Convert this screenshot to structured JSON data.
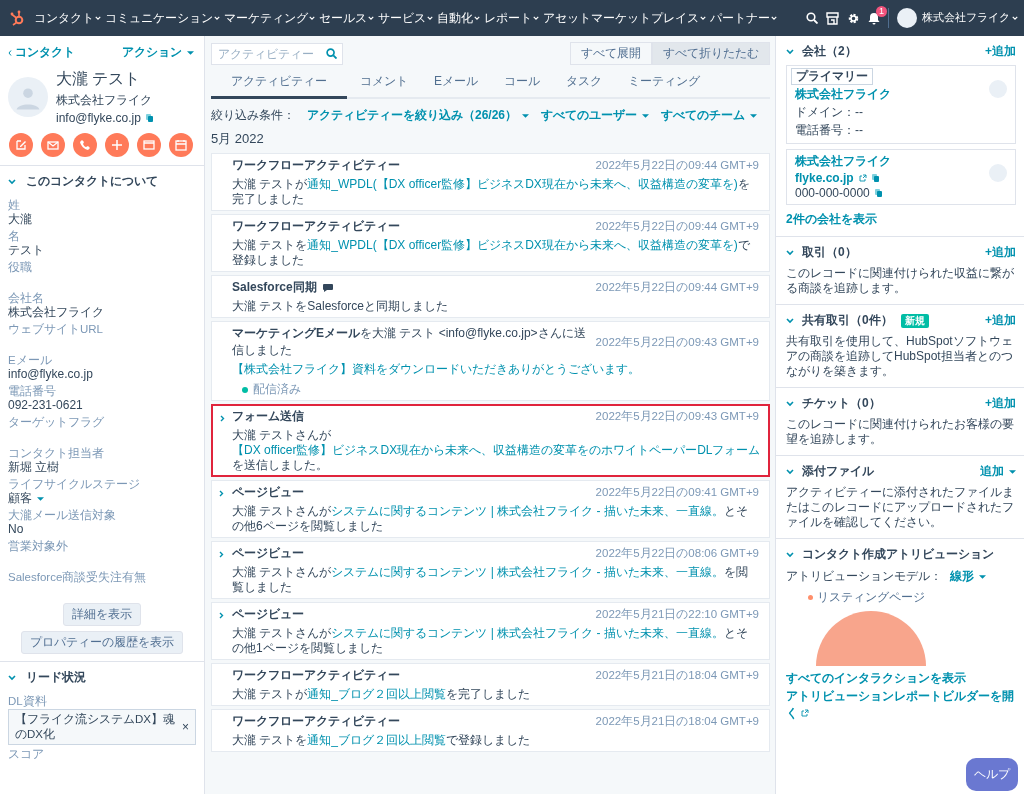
{
  "nav": {
    "items": [
      "コンタクト",
      "コミュニケーション",
      "マーケティング",
      "セールス",
      "サービス",
      "自動化",
      "レポート",
      "アセットマーケットプレイス",
      "パートナー"
    ],
    "notification_count": "1",
    "account": "株式会社フライク"
  },
  "contact": {
    "back": "コンタクト",
    "actions": "アクション",
    "name": "大瀧 テスト",
    "company": "株式会社フライク",
    "email": "info@flyke.co.jp"
  },
  "about": {
    "title": "このコンタクトについて",
    "expanded": true,
    "fields": [
      {
        "label": "姓",
        "kind": "text",
        "value": "大瀧"
      },
      {
        "label": "名",
        "kind": "text",
        "value": "テスト"
      },
      {
        "label": "役職",
        "kind": "text"
      },
      {
        "label": "会社名",
        "kind": "text",
        "value": "株式会社フライク"
      },
      {
        "label": "ウェブサイトURL",
        "kind": "text"
      },
      {
        "label": "Eメール",
        "kind": "text",
        "value": "info@flyke.co.jp"
      },
      {
        "label": "電話番号",
        "kind": "text",
        "value": "092-231-0621"
      },
      {
        "label": "ターゲットフラグ",
        "kind": "text"
      },
      {
        "label": "コンタクト担当者",
        "kind": "text",
        "value": "新堀 立樹"
      },
      {
        "label": "ライフサイクルステージ",
        "kind": "dropdown",
        "value": "顧客"
      },
      {
        "label": "大瀧メール送信対象",
        "kind": "text",
        "value": "No"
      },
      {
        "label": "営業対象外",
        "kind": "text"
      },
      {
        "label": "Salesforce商談受失注有無",
        "kind": "text"
      }
    ],
    "buttons": [
      "詳細を表示",
      "プロパティーの履歴を表示"
    ]
  },
  "lead": {
    "title": "リード状況",
    "expanded": true,
    "fields": [
      {
        "label": "DL資料",
        "kind": "tag",
        "value": "【フライク流システムDX】魂のDX化",
        "remove": "×"
      },
      {
        "label": "スコア",
        "kind": "text"
      }
    ]
  },
  "activity": {
    "search": {
      "placeholder": "アクティビティー"
    },
    "buttons": [
      {
        "label": "すべて展開",
        "selected": false
      },
      {
        "label": "すべて折りたたむ",
        "selected": true
      }
    ],
    "tabs": [
      {
        "label": "アクティビティー",
        "selected": true
      },
      {
        "label": "コメント",
        "selected": false
      },
      {
        "label": "Eメール",
        "selected": false
      },
      {
        "label": "コール",
        "selected": false
      },
      {
        "label": "タスク",
        "selected": false
      },
      {
        "label": "ミーティング",
        "selected": false
      }
    ],
    "filter_label": "絞り込み条件：",
    "filters": [
      "アクティビティーを絞り込み（26/26）",
      "すべてのユーザー",
      "すべてのチーム"
    ],
    "month": "5月 2022",
    "cards": [
      {
        "kind": "workflow",
        "highlighted": false,
        "title": "ワークフローアクティビティー",
        "time": "2022年5月22日の09:44 GMT+9",
        "body": [
          {
            "text": "大瀧 テストが",
            "link": false
          },
          {
            "text": "通知_WPDL(【DX officer監修】ビジネスDX現在から未来へ、収益構造の変革を)",
            "link": true
          },
          {
            "text": "を完了しました",
            "link": false
          }
        ]
      },
      {
        "kind": "workflow",
        "highlighted": false,
        "title": "ワークフローアクティビティー",
        "time": "2022年5月22日の09:44 GMT+9",
        "body": [
          {
            "text": "大瀧 テストを",
            "link": false
          },
          {
            "text": "通知_WPDL(【DX officer監修】ビジネスDX現在から未来へ、収益構造の変革を)",
            "link": true
          },
          {
            "text": "で登録しました",
            "link": false
          }
        ]
      },
      {
        "kind": "sync",
        "highlighted": false,
        "title": "Salesforce同期",
        "time": "2022年5月22日の09:44 GMT+9",
        "body": [
          {
            "text": "大瀧 テストをSalesforceと同期しました",
            "link": false
          }
        ]
      },
      {
        "kind": "email",
        "highlighted": false,
        "title": "**マーケティングEメール**を大瀧 テスト <info@flyke.co.jp>さんに送信しました",
        "time": "2022年5月22日の09:43 GMT+9",
        "body": [
          {
            "text": "【株式会社フライク】資料をダウンロードいただきありがとうございます。",
            "link": true
          }
        ],
        "status": "配信済み"
      },
      {
        "kind": "form",
        "highlighted": true,
        "title": "フォーム送信",
        "time": "2022年5月22日の09:43 GMT+9",
        "body": [
          {
            "text": "大瀧 テストさんが",
            "link": false
          },
          {
            "text": "【DX officer監修】ビジネスDX現在から未来へ、収益構造の変革をのホワイトペーパーDLフォーム",
            "link": true
          },
          {
            "text": "を送信しました。",
            "link": false
          }
        ]
      },
      {
        "kind": "pageview",
        "highlighted": false,
        "title": "ページビュー",
        "time": "2022年5月22日の09:41 GMT+9",
        "body": [
          {
            "text": "大瀧 テストさんが",
            "link": false
          },
          {
            "text": "システムに関するコンテンツ | 株式会社フライク - 描いた未来、一直線。",
            "link": true
          },
          {
            "text": "とその他6ページを閲覧しました",
            "link": false
          }
        ]
      },
      {
        "kind": "pageview",
        "highlighted": false,
        "title": "ページビュー",
        "time": "2022年5月22日の08:06 GMT+9",
        "body": [
          {
            "text": "大瀧 テストさんが",
            "link": false
          },
          {
            "text": "システムに関するコンテンツ | 株式会社フライク - 描いた未来、一直線。",
            "link": true
          },
          {
            "text": "を閲覧しました",
            "link": false
          }
        ]
      },
      {
        "kind": "pageview",
        "highlighted": false,
        "title": "ページビュー",
        "time": "2022年5月21日の22:10 GMT+9",
        "body": [
          {
            "text": "大瀧 テストさんが",
            "link": false
          },
          {
            "text": "システムに関するコンテンツ | 株式会社フライク - 描いた未来、一直線。",
            "link": true
          },
          {
            "text": "とその他1ページを閲覧しました",
            "link": false
          }
        ]
      },
      {
        "kind": "workflow",
        "highlighted": false,
        "title": "ワークフローアクティビティー",
        "time": "2022年5月21日の18:04 GMT+9",
        "body": [
          {
            "text": "大瀧 テストが",
            "link": false
          },
          {
            "text": "通知_ブログ２回以上閲覧",
            "link": true
          },
          {
            "text": "を完了しました",
            "link": false
          }
        ]
      },
      {
        "kind": "workflow",
        "highlighted": false,
        "title": "ワークフローアクティビティー",
        "time": "2022年5月21日の18:04 GMT+9",
        "body": [
          {
            "text": "大瀧 テストを",
            "link": false
          },
          {
            "text": "通知_ブログ２回以上閲覧",
            "link": true
          },
          {
            "text": "で登録しました",
            "link": false
          }
        ]
      }
    ]
  },
  "sidebar": {
    "sections": [
      {
        "kind": "companies",
        "title": "会社（2）",
        "expanded": true,
        "add": "+追加",
        "companies": [
          {
            "primary_label": "プライマリー",
            "name": "株式会社フライク",
            "lines": [
              {
                "kind": "text",
                "text": "ドメイン：--"
              },
              {
                "kind": "text",
                "text": "電話番号：--"
              }
            ]
          },
          {
            "name": "株式会社フライク",
            "lines": [
              {
                "kind": "external",
                "text": "flyke.co.jp"
              },
              {
                "kind": "copy",
                "text": "000-000-0000"
              }
            ]
          }
        ],
        "footer": "2件の会社を表示"
      },
      {
        "kind": "text",
        "title": "取引（0）",
        "expanded": true,
        "add": "+追加",
        "text": "このレコードに関連付けられた収益に繋がる商談を追跡します。"
      },
      {
        "kind": "text",
        "title": "共有取引（0件）",
        "badge": "新規",
        "expanded": true,
        "add": "+追加",
        "text": "共有取引を使用して、HubSpotソフトウェアの商談を追跡してHubSpot担当者とのつながりを築きます。"
      },
      {
        "kind": "text",
        "title": "チケット（0）",
        "expanded": true,
        "add": "+追加",
        "text": "このレコードに関連付けられたお客様の要望を追跡します。"
      },
      {
        "kind": "text",
        "title": "添付ファイル",
        "expanded": true,
        "add_menu": "追加",
        "text": "アクティビティーに添付されたファイルまたはこのレコードにアップロードされたファイルを確認してください。"
      },
      {
        "kind": "attribution",
        "title": "コンタクト作成アトリビューション",
        "expanded": true,
        "model_label": "アトリビューションモデル：",
        "model": "線形",
        "legend": "リスティングページ",
        "links": [
          "すべてのインタラクションを表示",
          "アトリビューションレポートビルダーを開く"
        ]
      }
    ]
  },
  "help": "ヘルプ"
}
